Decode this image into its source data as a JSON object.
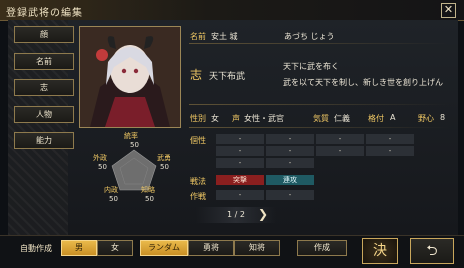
{
  "window": {
    "title": "登録武将の編集",
    "close_icon": "close-icon"
  },
  "menu": [
    "顔",
    "名前",
    "志",
    "人物",
    "能力"
  ],
  "stats": {
    "labels": {
      "top": "統率",
      "upper_left": "外政",
      "upper_right": "武勇",
      "lower_left": "内政",
      "lower_right": "知略"
    },
    "values": {
      "top": "50",
      "upper_left": "50",
      "upper_right": "50",
      "lower_left": "50",
      "lower_right": "50"
    }
  },
  "info": {
    "name_label": "名前",
    "name": "安土 城",
    "reading": "あづち じょう",
    "ambition_mark": "志",
    "ambition_title": "天下布武",
    "ambition_text_line1": "天下に武を布く",
    "ambition_text_line2": "武を以て天下を制し、新しき世を創り上げん",
    "gender_label": "性別",
    "gender": "女",
    "voice_label": "声",
    "voice": "女性・武官",
    "temperament_label": "気質",
    "temperament": "仁義",
    "rank_label": "格付",
    "rank": "A",
    "ambition_level_label": "野心",
    "ambition_level": "8",
    "traits_label": "個性",
    "tactic_label": "戦法",
    "tactic1": "突撃",
    "tactic2": "連攻",
    "strategy_label": "作戦",
    "dash": "-"
  },
  "pager": {
    "text": "1 / 2",
    "next_icon": "chevron-right-icon"
  },
  "bottom": {
    "auto_label": "自動作成",
    "male": "男",
    "female": "女",
    "random": "ランダム",
    "brave": "勇将",
    "wise": "知将",
    "create": "作成",
    "confirm": "決",
    "back_icon": "return-arrow-icon"
  },
  "colors": {
    "accent": "#f0c864",
    "selected": "#e9b94a",
    "skill_red": "#8a1f1f",
    "skill_teal": "#1f5a63"
  }
}
